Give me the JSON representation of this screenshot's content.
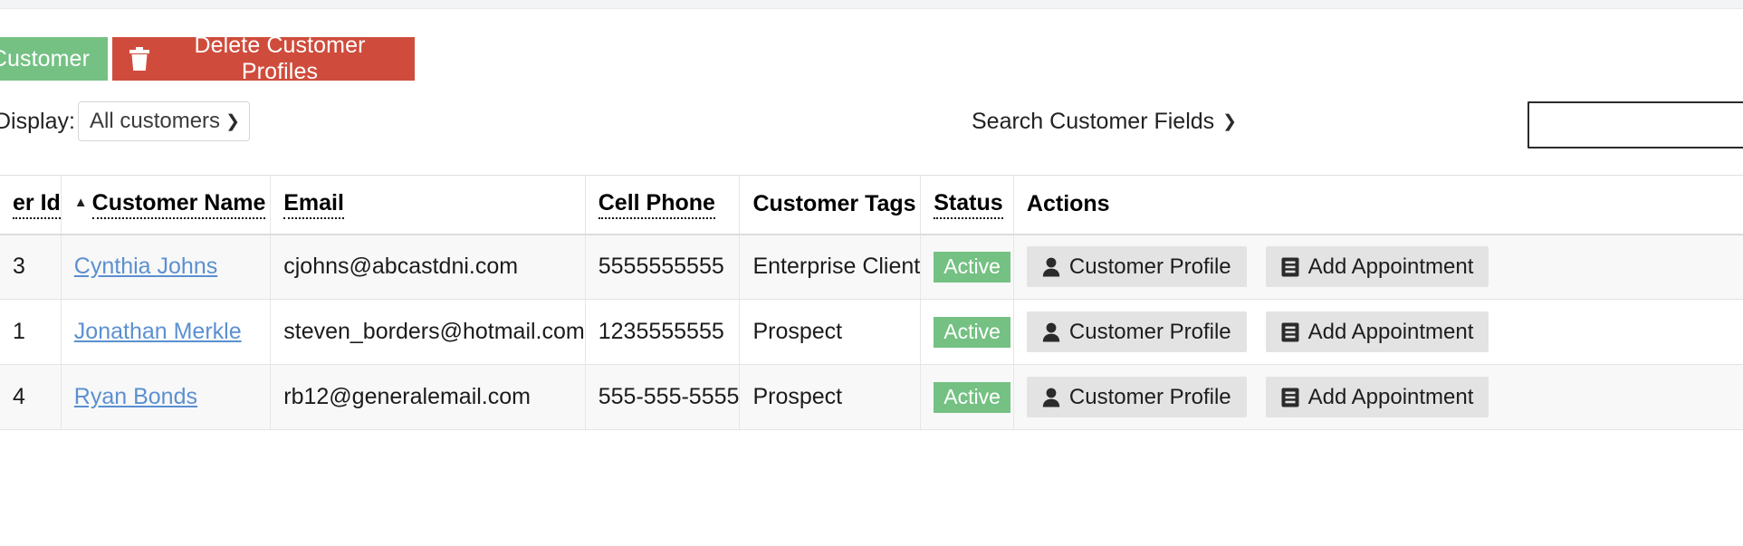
{
  "toolbar": {
    "add_customer_label": "Customer",
    "delete_label": "Delete Customer Profiles",
    "trash_icon": "trash-icon"
  },
  "filters": {
    "display_label": "Display:",
    "display_value": "All customers",
    "display_options": [
      "All customers"
    ],
    "search_fields_label": "Search Customer Fields",
    "chevron_icon": "chevron-down-icon",
    "search_value": "",
    "search_placeholder": ""
  },
  "table": {
    "columns": [
      {
        "label": "er Id",
        "sortable": true,
        "sorted": false
      },
      {
        "label": "Customer Name",
        "sortable": true,
        "sorted": true,
        "sort_dir": "asc"
      },
      {
        "label": "Email",
        "sortable": true,
        "sorted": false
      },
      {
        "label": "Cell Phone",
        "sortable": true,
        "sorted": false
      },
      {
        "label": "Customer Tags",
        "sortable": false,
        "sorted": false
      },
      {
        "label": "Status",
        "sortable": true,
        "sorted": false
      },
      {
        "label": "Actions",
        "sortable": false,
        "sorted": false
      }
    ],
    "rows": [
      {
        "id": "3",
        "name": "Cynthia Johns",
        "email": "cjohns@abcastdni.com",
        "phone": "5555555555",
        "tags": "Enterprise Client",
        "status": "Active",
        "profile_label": "Customer Profile",
        "appointment_label": "Add Appointment"
      },
      {
        "id": "1",
        "name": "Jonathan Merkle",
        "email": "steven_borders@hotmail.com",
        "phone": "1235555555",
        "tags": "Prospect",
        "status": "Active",
        "profile_label": "Customer Profile",
        "appointment_label": "Add Appointment"
      },
      {
        "id": "4",
        "name": "Ryan Bonds",
        "email": "rb12@generalemail.com",
        "phone": "555-555-5555",
        "tags": "Prospect",
        "status": "Active",
        "profile_label": "Customer Profile",
        "appointment_label": "Add Appointment"
      }
    ]
  },
  "colors": {
    "green": "#74c183",
    "red": "#cf4c3c",
    "link": "#5b90d0",
    "button_gray": "#e3e3e3"
  }
}
